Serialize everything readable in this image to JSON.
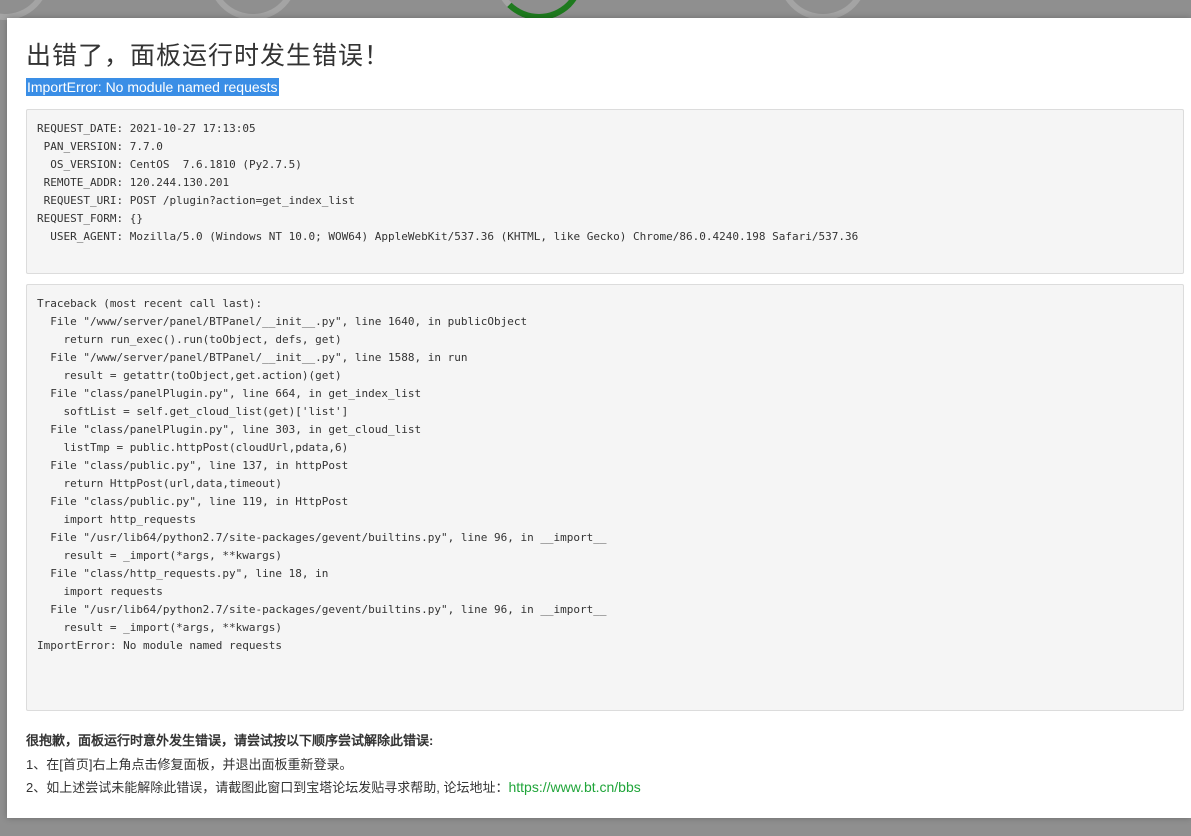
{
  "dialog": {
    "title": "出错了，面板运行时发生错误！",
    "error_line": "ImportError: No module named requests"
  },
  "env_info": [
    {
      "key": "REQUEST_DATE",
      "value": "2021-10-27 17:13:05"
    },
    {
      "key": "PAN_VERSION",
      "value": "7.7.0"
    },
    {
      "key": "OS_VERSION",
      "value": "CentOS  7.6.1810 (Py2.7.5)"
    },
    {
      "key": "REMOTE_ADDR",
      "value": "120.244.130.201"
    },
    {
      "key": "REQUEST_URI",
      "value": "POST /plugin?action=get_index_list"
    },
    {
      "key": "REQUEST_FORM",
      "value": "{}"
    },
    {
      "key": "USER_AGENT",
      "value": "Mozilla/5.0 (Windows NT 10.0; WOW64) AppleWebKit/537.36 (KHTML, like Gecko) Chrome/86.0.4240.198 Safari/537.36"
    }
  ],
  "traceback": [
    "Traceback (most recent call last):",
    "  File \"/www/server/panel/BTPanel/__init__.py\", line 1640, in publicObject",
    "    return run_exec().run(toObject, defs, get)",
    "  File \"/www/server/panel/BTPanel/__init__.py\", line 1588, in run",
    "    result = getattr(toObject,get.action)(get)",
    "  File \"class/panelPlugin.py\", line 664, in get_index_list",
    "    softList = self.get_cloud_list(get)['list']",
    "  File \"class/panelPlugin.py\", line 303, in get_cloud_list",
    "    listTmp = public.httpPost(cloudUrl,pdata,6)",
    "  File \"class/public.py\", line 137, in httpPost",
    "    return HttpPost(url,data,timeout)",
    "  File \"class/public.py\", line 119, in HttpPost",
    "    import http_requests",
    "  File \"/usr/lib64/python2.7/site-packages/gevent/builtins.py\", line 96, in __import__",
    "    result = _import(*args, **kwargs)",
    "  File \"class/http_requests.py\", line 18, in",
    "    import requests",
    "  File \"/usr/lib64/python2.7/site-packages/gevent/builtins.py\", line 96, in __import__",
    "    result = _import(*args, **kwargs)",
    "ImportError: No module named requests"
  ],
  "help": {
    "title": "很抱歉，面板运行时意外发生错误，请尝试按以下顺序尝试解除此错误:",
    "step1": "1、在[首页]右上角点击修复面板，并退出面板重新登录。",
    "step2_prefix": "2、如上述尝试未能解除此错误，请截图此窗口到宝塔论坛发贴寻求帮助, 论坛地址：",
    "forum_link": "https://www.bt.cn/bbs"
  },
  "colors": {
    "link": "#20a53a",
    "selection": "#3a8ee6",
    "backdrop": "#8f8f8f"
  }
}
